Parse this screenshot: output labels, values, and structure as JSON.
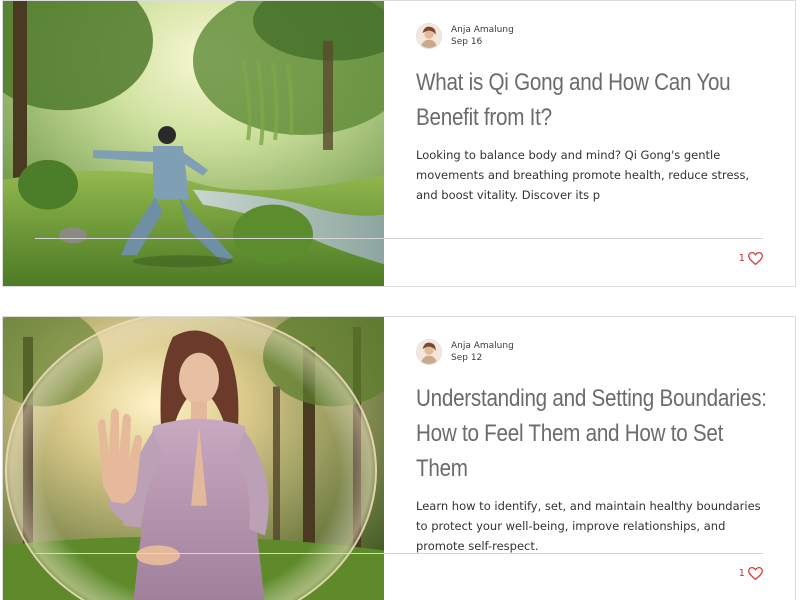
{
  "posts": [
    {
      "author": "Anja Amalung",
      "date": "Sep 16",
      "title": "What is Qi Gong and How Can You Benefit from It?",
      "excerpt": "Looking to balance body and mind? Qi Gong's gentle movements and breathing promote health, reduce stress, and boost vitality. Discover its p",
      "likes": "1",
      "image": "person-practicing-qi-gong-by-river"
    },
    {
      "author": "Anja Amalung",
      "date": "Sep 12",
      "title": "Understanding and Setting Boundaries: How to Feel Them and How to Set Them",
      "excerpt": "Learn how to identify, set, and maintain healthy boundaries to protect your well-being, improve relationships, and promote self-respect.",
      "likes": "1",
      "image": "woman-in-bubble-raising-hand"
    }
  ],
  "icons": {
    "like": "heart-icon",
    "avatar": "author-avatar"
  },
  "colors": {
    "heart": "#d63a3a",
    "title": "#6b6b6b",
    "text": "#333333",
    "border": "#dcdcdc"
  }
}
